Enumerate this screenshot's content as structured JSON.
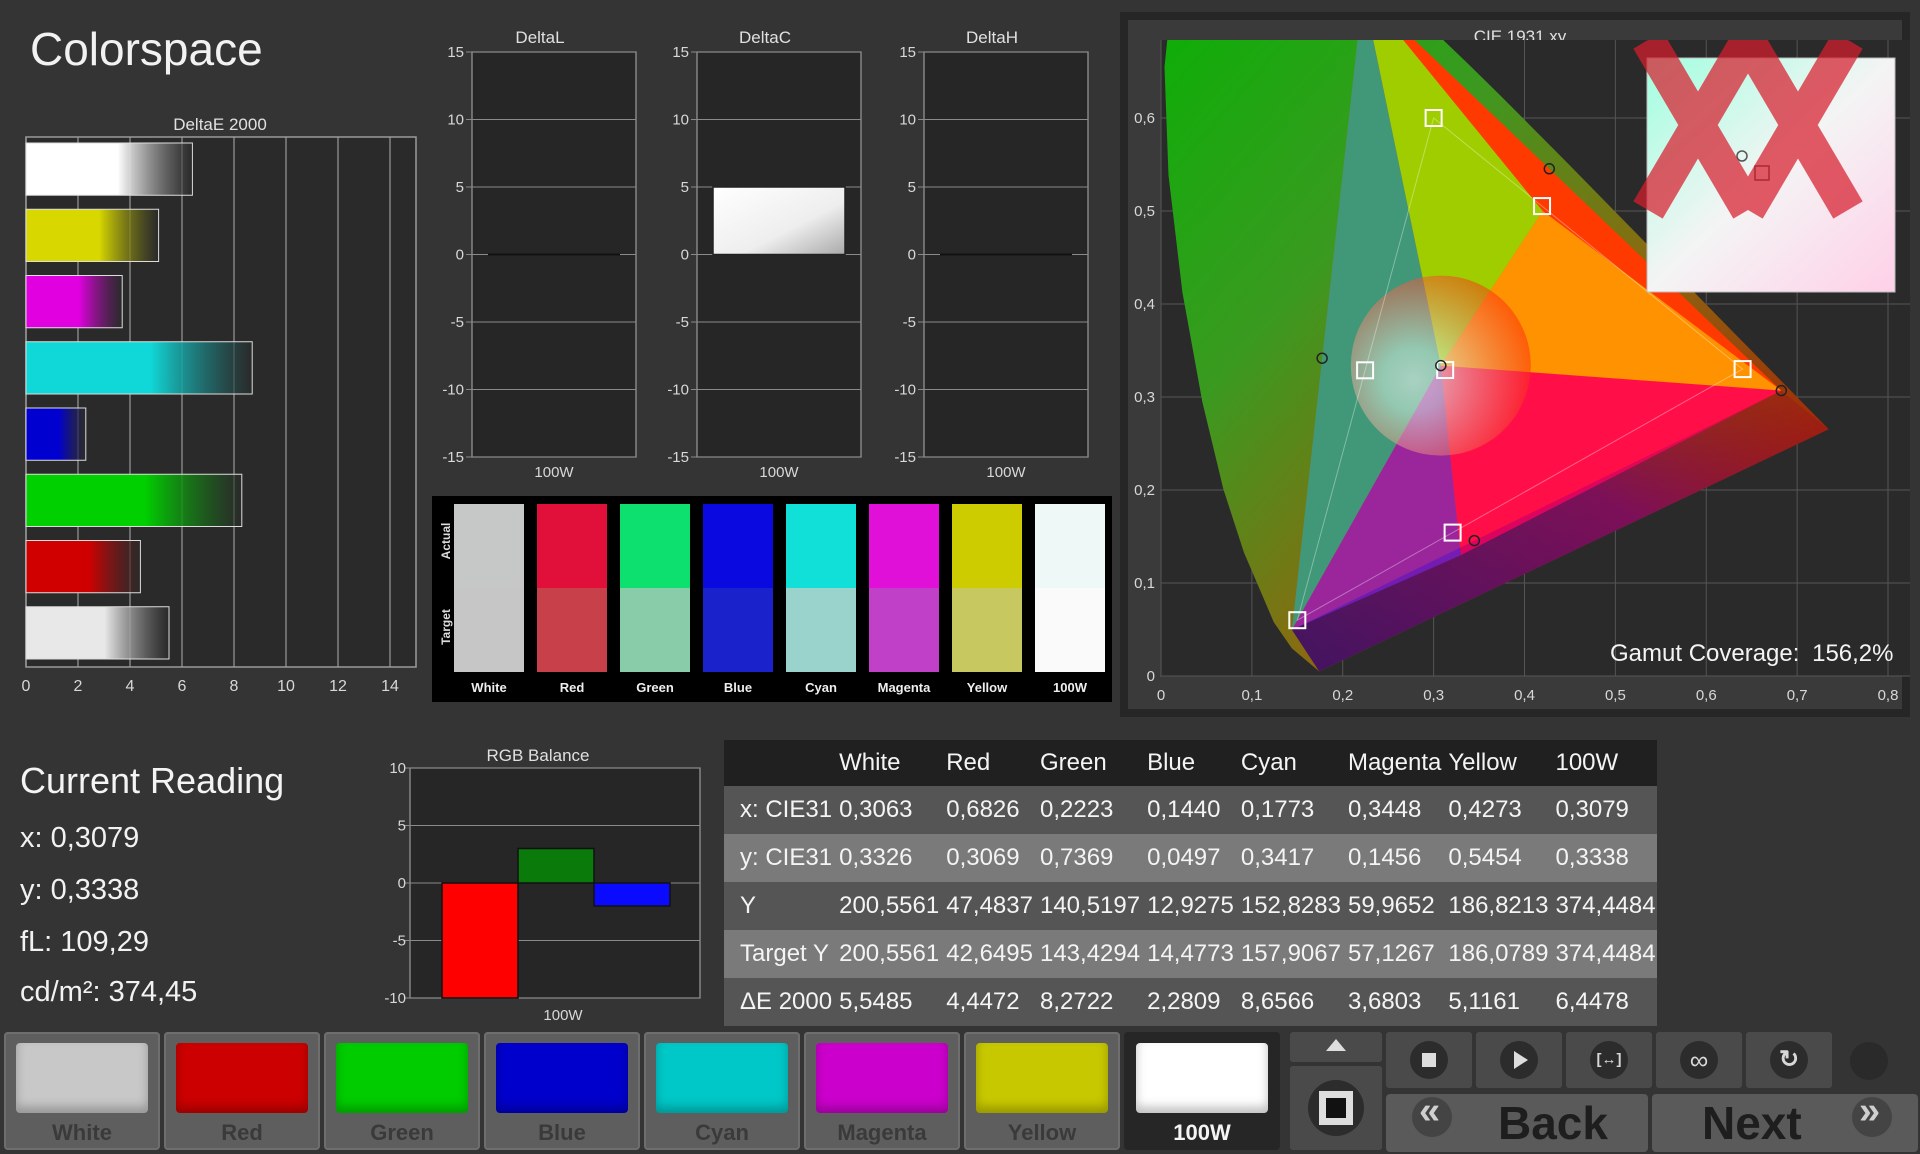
{
  "title": "Colorspace",
  "deltae_chart": {
    "title": "DeltaE 2000",
    "xticks": [
      "0",
      "2",
      "4",
      "6",
      "8",
      "10",
      "12",
      "14"
    ]
  },
  "delta_charts": [
    {
      "title": "DeltaL",
      "xlabel": "100W",
      "yticks": [
        "15",
        "10",
        "5",
        "0",
        "-5",
        "-10",
        "-15"
      ]
    },
    {
      "title": "DeltaC",
      "xlabel": "100W",
      "yticks": [
        "15",
        "10",
        "5",
        "0",
        "-5",
        "-10",
        "-15"
      ]
    },
    {
      "title": "DeltaH",
      "xlabel": "100W",
      "yticks": [
        "15",
        "10",
        "5",
        "0",
        "-5",
        "-10",
        "-15"
      ]
    }
  ],
  "swatch_panel": {
    "actual_label": "Actual",
    "target_label": "Target",
    "swatches": [
      {
        "label": "White",
        "actual": "#c6c8c7",
        "target": "#c6c6c6"
      },
      {
        "label": "Red",
        "actual": "#e0103a",
        "target": "#c8404a"
      },
      {
        "label": "Green",
        "actual": "#0ee070",
        "target": "#88ccaa"
      },
      {
        "label": "Blue",
        "actual": "#0a0ae0",
        "target": "#1a22cc"
      },
      {
        "label": "Cyan",
        "actual": "#10e0d8",
        "target": "#9ad2cc"
      },
      {
        "label": "Magenta",
        "actual": "#e010d8",
        "target": "#c040c8"
      },
      {
        "label": "Yellow",
        "actual": "#cccc00",
        "target": "#c8c860"
      },
      {
        "label": "100W",
        "actual": "#eef8f6",
        "target": "#fafafa"
      }
    ]
  },
  "cie_chart": {
    "title": "CIE 1931 xy",
    "xticks": [
      "0",
      "0,1",
      "0,2",
      "0,3",
      "0,4",
      "0,5",
      "0,6",
      "0,7",
      "0,8"
    ],
    "yticks": [
      "0",
      "0,1",
      "0,2",
      "0,3",
      "0,4",
      "0,5",
      "0,6",
      "0,7",
      "0,8"
    ],
    "gamut_label": "Gamut Coverage:",
    "gamut_value": "156,2%"
  },
  "current_reading": {
    "heading": "Current Reading",
    "x": "x: 0,3079",
    "y": "y: 0,3338",
    "fl": "fL: 109,29",
    "cdm2": "cd/m²: 374,45"
  },
  "rgb_balance": {
    "title": "RGB Balance",
    "xlabel": "100W",
    "yticks": [
      "10",
      "5",
      "0",
      "-5",
      "-10"
    ]
  },
  "table": {
    "headers": [
      "",
      "White",
      "Red",
      "Green",
      "Blue",
      "Cyan",
      "Magenta",
      "Yellow",
      "100W"
    ],
    "rows": [
      [
        "x: CIE31",
        "0,3063",
        "0,6826",
        "0,2223",
        "0,1440",
        "0,1773",
        "0,3448",
        "0,4273",
        "0,3079"
      ],
      [
        "y: CIE31",
        "0,3326",
        "0,3069",
        "0,7369",
        "0,0497",
        "0,3417",
        "0,1456",
        "0,5454",
        "0,3338"
      ],
      [
        "Y",
        "200,5561",
        "47,4837",
        "140,5197",
        "12,9275",
        "152,8283",
        "59,9652",
        "186,8213",
        "374,4484"
      ],
      [
        "Target Y",
        "200,5561",
        "42,6495",
        "143,4294",
        "14,4773",
        "157,9067",
        "57,1267",
        "186,0789",
        "374,4484"
      ],
      [
        "ΔE 2000",
        "5,5485",
        "4,4472",
        "8,2722",
        "2,2809",
        "8,6566",
        "3,6803",
        "5,1161",
        "6,4478"
      ]
    ]
  },
  "color_buttons": [
    {
      "label": "White",
      "color": "#c8c8c8"
    },
    {
      "label": "Red",
      "color": "#cc0000"
    },
    {
      "label": "Green",
      "color": "#00cc00"
    },
    {
      "label": "Blue",
      "color": "#0000cc"
    },
    {
      "label": "Cyan",
      "color": "#00c8c8"
    },
    {
      "label": "Magenta",
      "color": "#cc00cc"
    },
    {
      "label": "Yellow",
      "color": "#c8c800"
    },
    {
      "label": "100W",
      "color": "#ffffff"
    }
  ],
  "nav": {
    "back_label": "Back",
    "next_label": "Next",
    "back_chevron": "«",
    "next_chevron": "»"
  },
  "controls": {
    "up_icon": "triangle-up-icon",
    "record_icon": "stop-square-icon",
    "stop_icon": "stop-icon",
    "play_icon": "play-icon",
    "bracket_icon": "bracket-icon",
    "loop_icon": "infinity-icon",
    "refresh_icon": "refresh-icon",
    "power_icon": "circle-icon"
  },
  "chart_data": [
    {
      "type": "bar",
      "title": "DeltaE 2000",
      "orientation": "horizontal",
      "categories": [
        "White",
        "Yellow",
        "Magenta",
        "Cyan",
        "Blue",
        "Green",
        "Red",
        "100W"
      ],
      "values": [
        6.4,
        5.1,
        3.7,
        8.7,
        2.3,
        8.3,
        4.4,
        5.5
      ],
      "colors": [
        "#ffffff",
        "#d8d800",
        "#e000e0",
        "#10d8d8",
        "#0000d0",
        "#00d000",
        "#d00000",
        "#e8e8e8"
      ],
      "xlim": [
        0,
        15
      ]
    },
    {
      "type": "bar",
      "title": "DeltaL",
      "categories": [
        "100W"
      ],
      "values": [
        0
      ],
      "ylim": [
        -15,
        15
      ]
    },
    {
      "type": "bar",
      "title": "DeltaC",
      "categories": [
        "100W"
      ],
      "values": [
        5
      ],
      "ylim": [
        -15,
        15
      ]
    },
    {
      "type": "bar",
      "title": "DeltaH",
      "categories": [
        "100W"
      ],
      "values": [
        0
      ],
      "ylim": [
        -15,
        15
      ]
    },
    {
      "type": "bar",
      "title": "RGB Balance",
      "categories": [
        "100W"
      ],
      "series": [
        {
          "color": "#ff0000",
          "values": [
            -10
          ]
        },
        {
          "color": "#0a7a0a",
          "values": [
            3
          ]
        },
        {
          "color": "#0a0aff",
          "values": [
            -2
          ]
        }
      ],
      "ylim": [
        -10,
        10
      ]
    },
    {
      "type": "scatter",
      "title": "CIE 1931 xy",
      "xlim": [
        0,
        0.8
      ],
      "ylim": [
        0,
        0.8
      ],
      "target_gamut": [
        [
          0.64,
          0.33
        ],
        [
          0.3,
          0.6
        ],
        [
          0.15,
          0.06
        ]
      ],
      "targets": [
        [
          0.3127,
          0.329
        ],
        [
          0.64,
          0.33
        ],
        [
          0.3,
          0.6
        ],
        [
          0.15,
          0.06
        ],
        [
          0.2246,
          0.3287
        ],
        [
          0.3209,
          0.1542
        ],
        [
          0.4193,
          0.5053
        ]
      ],
      "measured": [
        [
          0.3079,
          0.3338
        ],
        [
          0.6826,
          0.3069
        ],
        [
          0.2223,
          0.7369
        ],
        [
          0.1773,
          0.3417
        ],
        [
          0.3448,
          0.1456
        ],
        [
          0.4273,
          0.5454
        ]
      ],
      "measured_gamut": [
        [
          0.6826,
          0.3069
        ],
        [
          0.2223,
          0.7369
        ],
        [
          0.144,
          0.0497
        ]
      ]
    }
  ]
}
